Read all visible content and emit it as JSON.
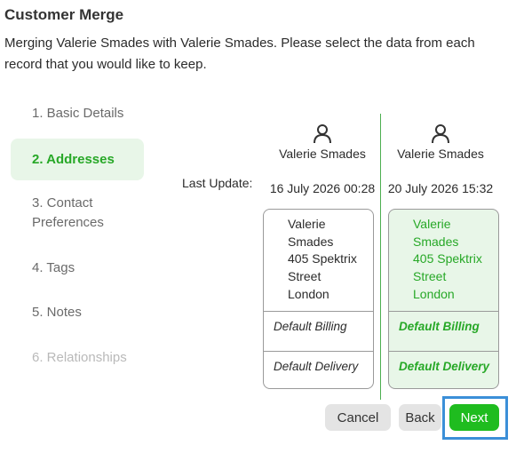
{
  "dialog": {
    "title": "Customer Merge",
    "intro": "Merging Valerie Smades with Valerie Smades. Please select the data from each record that you would like to keep."
  },
  "steps": [
    {
      "label": "1. Basic Details",
      "state": "normal"
    },
    {
      "label": "2. Addresses",
      "state": "active"
    },
    {
      "label": "3. Contact Preferences",
      "state": "normal"
    },
    {
      "label": "4. Tags",
      "state": "normal"
    },
    {
      "label": "5. Notes",
      "state": "normal"
    },
    {
      "label": "6. Relationships",
      "state": "disabled"
    }
  ],
  "last_update_label": "Last Update:",
  "records": [
    {
      "name": "Valerie Smades",
      "last_update": "16 July 2026 00:28",
      "address_lines": [
        "Valerie",
        "Smades",
        "405 Spektrix",
        "Street",
        "London"
      ],
      "billing": "Default Billing",
      "delivery": "Default Delivery",
      "selected": false
    },
    {
      "name": "Valerie Smades",
      "last_update": "20 July 2026 15:32",
      "address_lines": [
        "Valerie",
        "Smades",
        "405 Spektrix",
        "Street",
        "London"
      ],
      "billing": "Default Billing",
      "delivery": "Default Delivery",
      "selected": true
    }
  ],
  "buttons": {
    "cancel": "Cancel",
    "back": "Back",
    "next": "Next"
  },
  "colors": {
    "accent_green": "#27a827",
    "selected_bg": "#e8f6e8",
    "focus_ring": "#3b8fd8"
  },
  "icons": {
    "record_icon": "person-icon"
  }
}
